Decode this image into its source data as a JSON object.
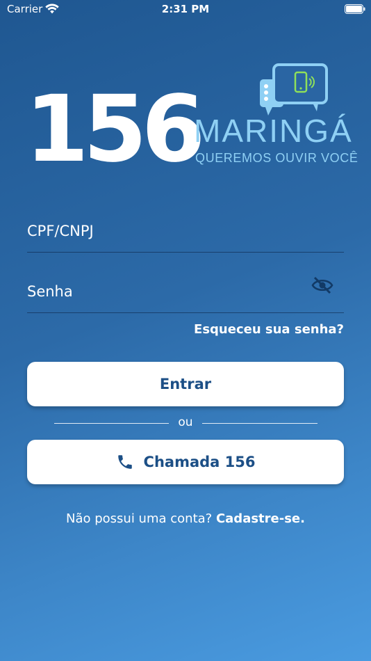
{
  "status_bar": {
    "carrier": "Carrier",
    "time": "2:31 PM"
  },
  "logo": {
    "number": "156",
    "city": "MARINGÁ",
    "tagline": "QUEREMOS OUVIR VOCÊ"
  },
  "form": {
    "cpf_placeholder": "CPF/CNPJ",
    "cpf_value": "",
    "password_placeholder": "Senha",
    "password_value": "",
    "forgot_label": "Esqueceu sua senha?"
  },
  "buttons": {
    "login_label": "Entrar",
    "divider_label": "ou",
    "call_label": "Chamada 156"
  },
  "signup": {
    "prompt": "Não possui uma conta?",
    "link_label": "Cadastre-se."
  },
  "colors": {
    "background_top": "#1f5791",
    "background_bottom": "#4a9be0",
    "button_text": "#1c4f86",
    "logo_accent": "#8fd0f4",
    "icon_green": "#8fe05a"
  },
  "icons": {
    "wifi": "wifi-icon",
    "battery": "battery-icon",
    "eye": "eye-off-icon",
    "phone": "phone-icon",
    "chat": "chat-bubble-phone-icon"
  }
}
